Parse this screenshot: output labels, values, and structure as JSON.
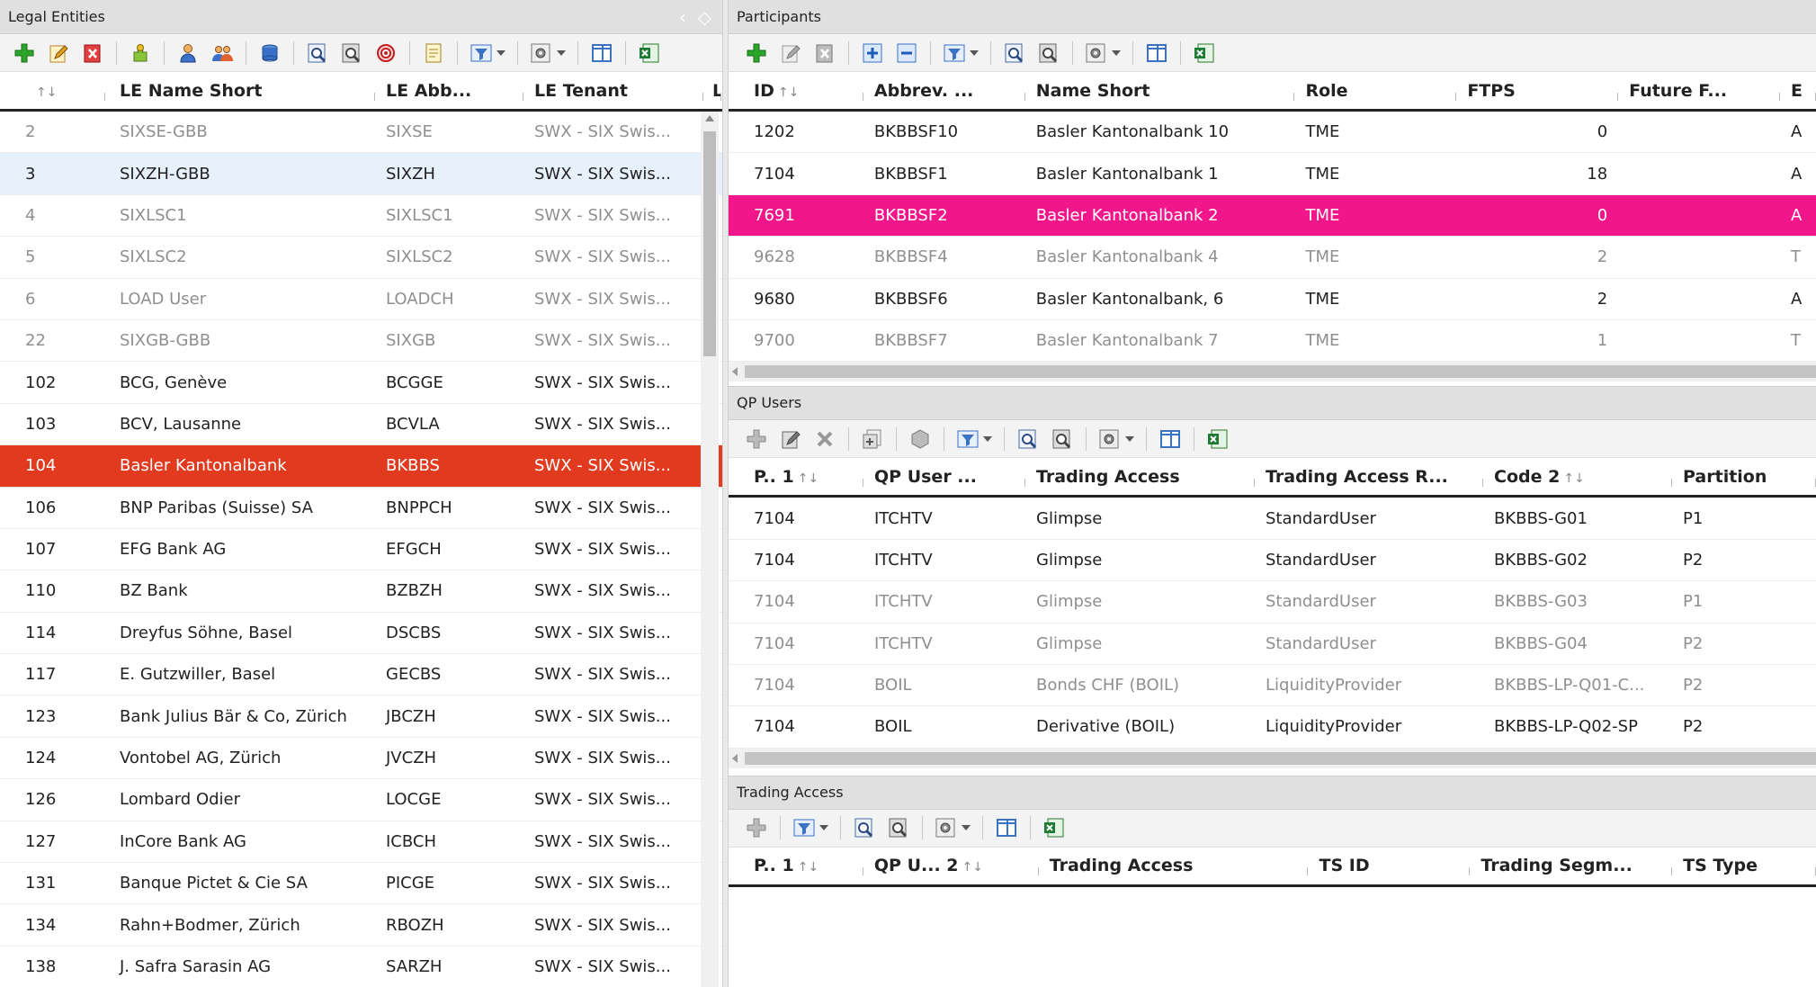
{
  "left": {
    "title": "Legal Entities",
    "columns": [
      "",
      "LE Name Short",
      "LE Abb...",
      "LE Tenant",
      "L"
    ],
    "rows": [
      {
        "id": "2",
        "name": "SIXSE-GBB",
        "abb": "SIXSE",
        "tenant": "SWX - SIX Swis...",
        "state": "dim"
      },
      {
        "id": "3",
        "name": "SIXZH-GBB",
        "abb": "SIXZH",
        "tenant": "SWX - SIX Swis...",
        "state": "hover"
      },
      {
        "id": "4",
        "name": "SIXLSC1",
        "abb": "SIXLSC1",
        "tenant": "SWX - SIX Swis...",
        "state": "dim"
      },
      {
        "id": "5",
        "name": "SIXLSC2",
        "abb": "SIXLSC2",
        "tenant": "SWX - SIX Swis...",
        "state": "dim"
      },
      {
        "id": "6",
        "name": "LOAD User",
        "abb": "LOADCH",
        "tenant": "SWX - SIX Swis...",
        "state": "dim"
      },
      {
        "id": "22",
        "name": "SIXGB-GBB",
        "abb": "SIXGB",
        "tenant": "SWX - SIX Swis...",
        "state": "dim"
      },
      {
        "id": "102",
        "name": "BCG, Genève",
        "abb": "BCGGE",
        "tenant": "SWX - SIX Swis...",
        "state": ""
      },
      {
        "id": "103",
        "name": "BCV, Lausanne",
        "abb": "BCVLA",
        "tenant": "SWX - SIX Swis...",
        "state": ""
      },
      {
        "id": "104",
        "name": "Basler Kantonalbank",
        "abb": "BKBBS",
        "tenant": "SWX - SIX Swis...",
        "state": "sel-red"
      },
      {
        "id": "106",
        "name": "BNP Paribas (Suisse) SA",
        "abb": "BNPPCH",
        "tenant": "SWX - SIX Swis...",
        "state": ""
      },
      {
        "id": "107",
        "name": "EFG Bank AG",
        "abb": "EFGCH",
        "tenant": "SWX - SIX Swis...",
        "state": ""
      },
      {
        "id": "110",
        "name": "BZ Bank",
        "abb": "BZBZH",
        "tenant": "SWX - SIX Swis...",
        "state": ""
      },
      {
        "id": "114",
        "name": "Dreyfus Söhne, Basel",
        "abb": "DSCBS",
        "tenant": "SWX - SIX Swis...",
        "state": ""
      },
      {
        "id": "117",
        "name": "E. Gutzwiller, Basel",
        "abb": "GECBS",
        "tenant": "SWX - SIX Swis...",
        "state": ""
      },
      {
        "id": "123",
        "name": "Bank Julius Bär & Co, Zürich",
        "abb": "JBCZH",
        "tenant": "SWX - SIX Swis...",
        "state": ""
      },
      {
        "id": "124",
        "name": "Vontobel AG, Zürich",
        "abb": "JVCZH",
        "tenant": "SWX - SIX Swis...",
        "state": ""
      },
      {
        "id": "126",
        "name": "Lombard Odier",
        "abb": "LOCGE",
        "tenant": "SWX - SIX Swis...",
        "state": ""
      },
      {
        "id": "127",
        "name": "InCore Bank AG",
        "abb": "ICBCH",
        "tenant": "SWX - SIX Swis...",
        "state": ""
      },
      {
        "id": "131",
        "name": "Banque Pictet & Cie SA",
        "abb": "PICGE",
        "tenant": "SWX - SIX Swis...",
        "state": ""
      },
      {
        "id": "134",
        "name": "Rahn+Bodmer, Zürich",
        "abb": "RBOZH",
        "tenant": "SWX - SIX Swis...",
        "state": ""
      },
      {
        "id": "138",
        "name": "J. Safra Sarasin AG",
        "abb": "SARZH",
        "tenant": "SWX - SIX Swis...",
        "state": ""
      }
    ]
  },
  "participants": {
    "title": "Participants",
    "columns": [
      "ID",
      "Abbrev. ...",
      "Name Short",
      "Role",
      "FTPS",
      "Future F...",
      "E"
    ],
    "rows": [
      {
        "id": "1202",
        "abbrev": "BKBBSF10",
        "name": "Basler Kantonalbank 10",
        "role": "TME",
        "ftps": "0",
        "future": "",
        "e": "A",
        "state": ""
      },
      {
        "id": "7104",
        "abbrev": "BKBBSF1",
        "name": "Basler Kantonalbank 1",
        "role": "TME",
        "ftps": "18",
        "future": "",
        "e": "A",
        "state": ""
      },
      {
        "id": "7691",
        "abbrev": "BKBBSF2",
        "name": "Basler Kantonalbank 2",
        "role": "TME",
        "ftps": "0",
        "future": "",
        "e": "A",
        "state": "sel-pink"
      },
      {
        "id": "9628",
        "abbrev": "BKBBSF4",
        "name": "Basler Kantonalbank 4",
        "role": "TME",
        "ftps": "2",
        "future": "",
        "e": "T",
        "state": "dim"
      },
      {
        "id": "9680",
        "abbrev": "BKBBSF6",
        "name": "Basler Kantonalbank, 6",
        "role": "TME",
        "ftps": "2",
        "future": "",
        "e": "A",
        "state": ""
      },
      {
        "id": "9700",
        "abbrev": "BKBBSF7",
        "name": "Basler Kantonalbank 7",
        "role": "TME",
        "ftps": "1",
        "future": "",
        "e": "T",
        "state": "dim"
      }
    ]
  },
  "qpusers": {
    "title": "QP Users",
    "columns": [
      "P..",
      "QP User ...",
      "Trading Access",
      "Trading Access R...",
      "Code",
      "Partition"
    ],
    "sort_first": "1",
    "sort_code": "2",
    "rows": [
      {
        "p": "7104",
        "user": "ITCHTV",
        "access": "Glimpse",
        "accessr": "StandardUser",
        "code": "BKBBS-G01",
        "part": "P1",
        "state": ""
      },
      {
        "p": "7104",
        "user": "ITCHTV",
        "access": "Glimpse",
        "accessr": "StandardUser",
        "code": "BKBBS-G02",
        "part": "P2",
        "state": ""
      },
      {
        "p": "7104",
        "user": "ITCHTV",
        "access": "Glimpse",
        "accessr": "StandardUser",
        "code": "BKBBS-G03",
        "part": "P1",
        "state": "dim"
      },
      {
        "p": "7104",
        "user": "ITCHTV",
        "access": "Glimpse",
        "accessr": "StandardUser",
        "code": "BKBBS-G04",
        "part": "P2",
        "state": "dim"
      },
      {
        "p": "7104",
        "user": "BOIL",
        "access": "Bonds CHF (BOIL)",
        "accessr": "LiquidityProvider",
        "code": "BKBBS-LP-Q01-C...",
        "part": "P2",
        "state": "dim"
      },
      {
        "p": "7104",
        "user": "BOIL",
        "access": "Derivative (BOIL)",
        "accessr": "LiquidityProvider",
        "code": "BKBBS-LP-Q02-SP",
        "part": "P2",
        "state": ""
      }
    ]
  },
  "trading": {
    "title": "Trading Access",
    "columns": [
      "P..",
      "QP U...",
      "Trading Access",
      "TS ID",
      "Trading Segm...",
      "TS Type"
    ],
    "sort_first": "1",
    "sort_second": "2"
  },
  "colors": {
    "selected_red": "#e23a1e",
    "selected_pink": "#f2168b",
    "hover": "#e6f1fb"
  }
}
